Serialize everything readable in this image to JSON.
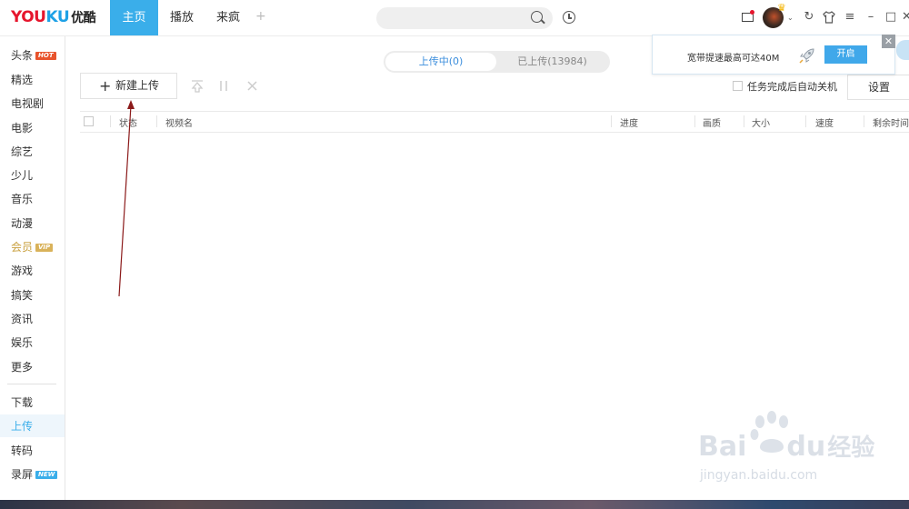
{
  "app": {
    "logo_latin_red": "YOU",
    "logo_latin_blue": "KU",
    "logo_cn": "优酷",
    "brand_red": "#e6162d",
    "brand_blue": "#1ea1e6"
  },
  "nav": {
    "tabs": [
      {
        "label": "主页",
        "active": true
      },
      {
        "label": "播放",
        "active": false
      },
      {
        "label": "来疯",
        "active": false
      }
    ],
    "add_tab": "+"
  },
  "search": {
    "value": "",
    "placeholder": ""
  },
  "window_controls": {
    "refresh": "↻",
    "skin": "⛉",
    "menu": "≡",
    "minimize": "–",
    "maximize": "□",
    "close": "✕"
  },
  "sidebar": {
    "items": [
      {
        "label": "头条",
        "badge": "HOT",
        "badge_color": "#e8532c"
      },
      {
        "label": "精选"
      },
      {
        "label": "电视剧"
      },
      {
        "label": "电影"
      },
      {
        "label": "综艺"
      },
      {
        "label": "少儿"
      },
      {
        "label": "音乐"
      },
      {
        "label": "动漫"
      },
      {
        "label": "会员",
        "badge": "VIP",
        "badge_color": "#d9b25a",
        "label_color": "#c9a03f"
      },
      {
        "label": "游戏"
      },
      {
        "label": "搞笑"
      },
      {
        "label": "资讯"
      },
      {
        "label": "娱乐"
      },
      {
        "label": "更多"
      }
    ],
    "tools": [
      {
        "label": "下载"
      },
      {
        "label": "上传",
        "active": true
      },
      {
        "label": "转码"
      },
      {
        "label": "录屏",
        "badge": "NEW",
        "badge_color": "#3aaeea"
      }
    ]
  },
  "upload": {
    "segments": {
      "uploading": "上传中(0)",
      "uploaded": "已上传(13984)"
    },
    "new_upload_label": "新建上传",
    "auto_shutdown_label": "任务完成后自动关机",
    "auto_shutdown_checked": false,
    "settings_label": "设置",
    "columns": [
      "状态",
      "视频名",
      "进度",
      "画质",
      "大小",
      "速度",
      "剩余时间"
    ]
  },
  "speed_popup": {
    "text": "宽带提速最高可达40M",
    "button": "开启",
    "close": "✕"
  },
  "watermark": {
    "main_left": "Bai",
    "main_right": "du",
    "main_cn": "经验",
    "sub": "jingyan.baidu.com"
  },
  "colors": {
    "accent": "#3aaeea",
    "annotation_arrow": "#8b1a1a"
  }
}
